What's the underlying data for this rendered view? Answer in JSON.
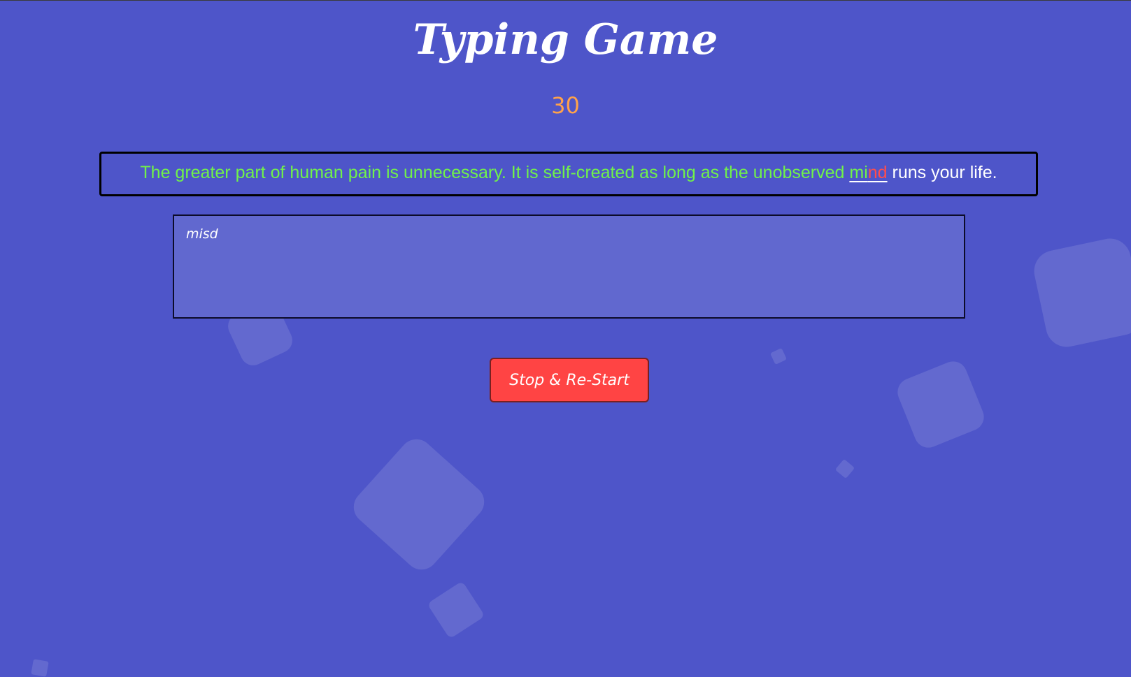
{
  "game": {
    "title": "Typing Game",
    "timer": "30"
  },
  "quote": {
    "typed": "The greater part of human pain is unnecessary. It is self-created as long as the unobserved ",
    "current_word_correct": "mi",
    "current_word_incorrect": "nd",
    "remaining": " runs your life."
  },
  "input": {
    "value": "misd"
  },
  "controls": {
    "restart_label": "Stop & Re-Start"
  },
  "colors": {
    "background": "#4e55c9",
    "correct": "#70f24a",
    "incorrect": "#ff4d4d",
    "timer": "#ffa24a",
    "button": "#ff4444"
  }
}
